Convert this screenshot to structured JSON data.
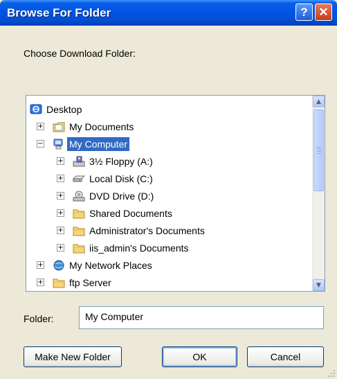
{
  "window": {
    "title": "Browse For Folder",
    "help_label": "?",
    "close_label": "✕"
  },
  "prompt": "Choose Download Folder:",
  "tree": {
    "items": [
      {
        "label": "Desktop",
        "icon": "desktop-icon"
      },
      {
        "label": "My Documents",
        "icon": "my-documents-icon",
        "expander": "+"
      },
      {
        "label": "My Computer",
        "icon": "my-computer-icon",
        "expander": "−",
        "selected": true
      },
      {
        "label": "3½ Floppy (A:)",
        "icon": "floppy-drive-icon",
        "expander": "+"
      },
      {
        "label": "Local Disk (C:)",
        "icon": "local-disk-icon",
        "expander": "+"
      },
      {
        "label": "DVD Drive (D:)",
        "icon": "dvd-drive-icon",
        "expander": "+"
      },
      {
        "label": "Shared Documents",
        "icon": "folder-icon",
        "expander": "+"
      },
      {
        "label": "Administrator's Documents",
        "icon": "folder-icon",
        "expander": "+"
      },
      {
        "label": "iis_admin's Documents",
        "icon": "folder-icon",
        "expander": "+"
      },
      {
        "label": "My Network Places",
        "icon": "network-places-icon",
        "expander": "+"
      },
      {
        "label": "ftp Server",
        "icon": "folder-icon",
        "expander": "+"
      }
    ]
  },
  "scrollbar": {
    "up": "▲",
    "down": "▼"
  },
  "folder": {
    "label": "Folder:",
    "value": "My Computer"
  },
  "buttons": {
    "make_new_folder": "Make New Folder",
    "ok": "OK",
    "cancel": "Cancel"
  },
  "colors": {
    "title_bar": "#0054e3",
    "selection": "#316ac5",
    "dialog_background": "#ece9d8"
  }
}
